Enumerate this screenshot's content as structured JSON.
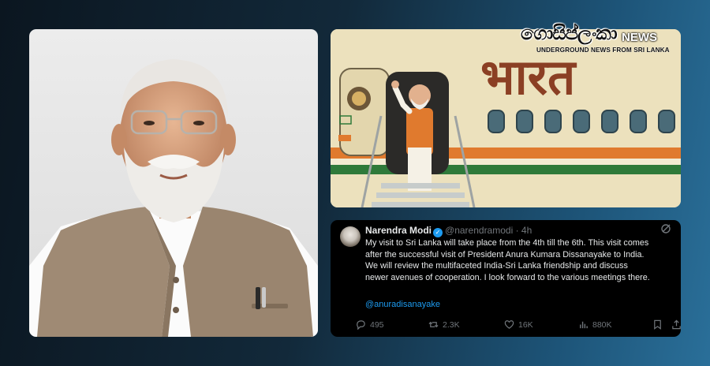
{
  "logo": {
    "brand": "ගොසිප්ලංකා",
    "news": "NEWS",
    "tagline": "UNDERGROUND NEWS FROM SRI LANKA"
  },
  "plane": {
    "fuselage_text": "भारत",
    "colors": {
      "saffron": "#e07a2e",
      "green": "#2f7a3a",
      "body": "#ece1bd"
    }
  },
  "tweet": {
    "name": "Narendra Modi",
    "handle": "@narendramodi",
    "time": "· 4h",
    "lines": [
      "My visit to Sri Lanka will take place from the 4th till the 6th. This visit comes",
      "after the successful visit of President Anura Kumara Dissanayake to India.",
      "We will review the multifaceted India-Sri Lanka friendship and discuss",
      "newer avenues of cooperation. I look forward to the various meetings there."
    ],
    "mention": "@anuradisanayake",
    "stats": {
      "replies": "495",
      "reposts": "2.3K",
      "likes": "16K",
      "views": "880K"
    },
    "icons": [
      "grok-icon",
      "more-icon",
      "reply-icon",
      "repost-icon",
      "like-icon",
      "views-icon",
      "bookmark-icon",
      "share-icon"
    ]
  }
}
